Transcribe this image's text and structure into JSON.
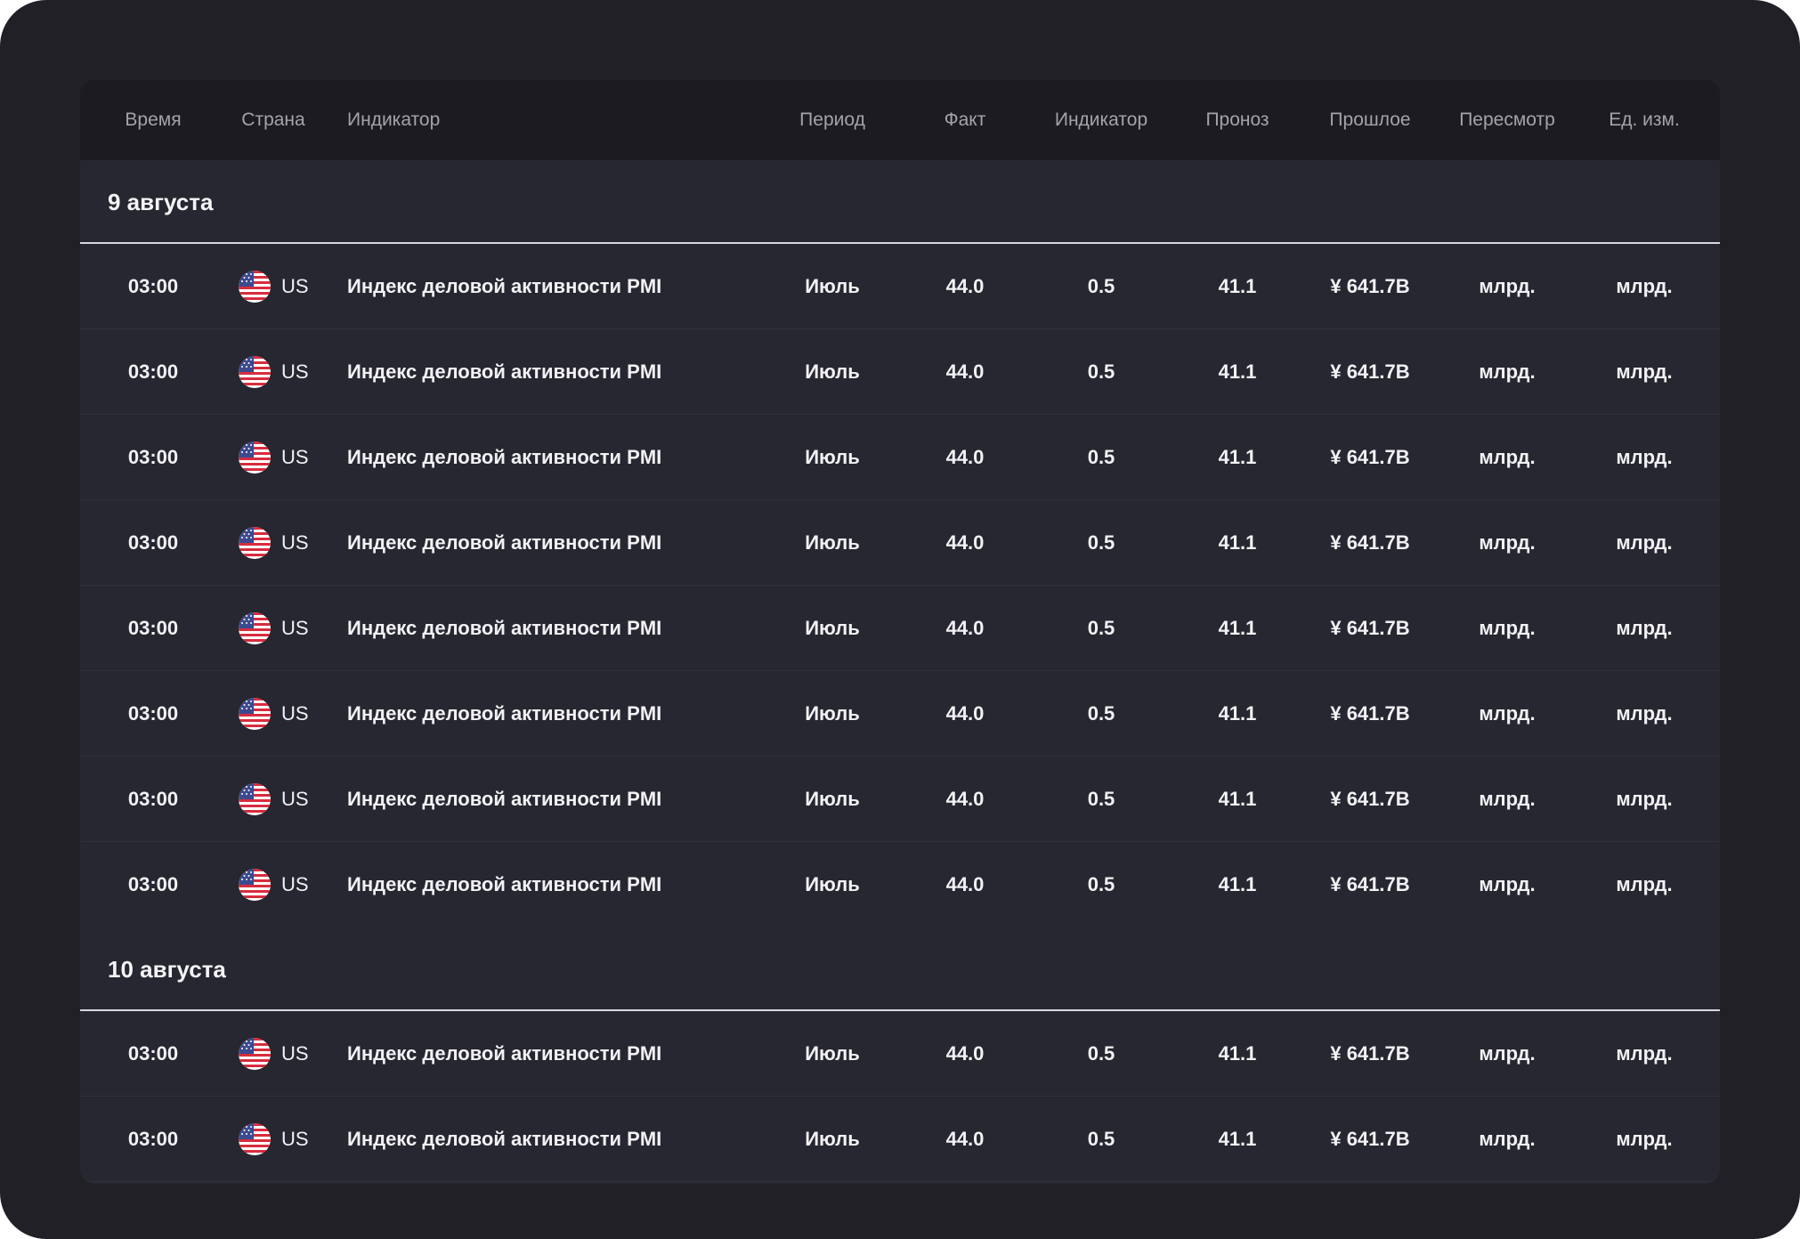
{
  "headers": {
    "time": "Время",
    "country": "Страна",
    "indicator": "Индикатор",
    "period": "Период",
    "actual": "Факт",
    "indicator2": "Индикатор",
    "forecast": "Проноз",
    "previous": "Прошлое",
    "revision": "Пересмотр",
    "unit": "Ед. изм."
  },
  "groups": [
    {
      "date": "9 августа",
      "rows": [
        {
          "time": "03:00",
          "country": "US",
          "indicator": "Индекс деловой активности PMI",
          "period": "Июль",
          "actual": "44.0",
          "indicator2": "0.5",
          "forecast": "41.1",
          "previous": "¥ 641.7B",
          "revision": "млрд.",
          "unit": "млрд."
        },
        {
          "time": "03:00",
          "country": "US",
          "indicator": "Индекс деловой активности PMI",
          "period": "Июль",
          "actual": "44.0",
          "indicator2": "0.5",
          "forecast": "41.1",
          "previous": "¥ 641.7B",
          "revision": "млрд.",
          "unit": "млрд."
        },
        {
          "time": "03:00",
          "country": "US",
          "indicator": "Индекс деловой активности PMI",
          "period": "Июль",
          "actual": "44.0",
          "indicator2": "0.5",
          "forecast": "41.1",
          "previous": "¥ 641.7B",
          "revision": "млрд.",
          "unit": "млрд."
        },
        {
          "time": "03:00",
          "country": "US",
          "indicator": "Индекс деловой активности PMI",
          "period": "Июль",
          "actual": "44.0",
          "indicator2": "0.5",
          "forecast": "41.1",
          "previous": "¥ 641.7B",
          "revision": "млрд.",
          "unit": "млрд."
        },
        {
          "time": "03:00",
          "country": "US",
          "indicator": "Индекс деловой активности PMI",
          "period": "Июль",
          "actual": "44.0",
          "indicator2": "0.5",
          "forecast": "41.1",
          "previous": "¥ 641.7B",
          "revision": "млрд.",
          "unit": "млрд."
        },
        {
          "time": "03:00",
          "country": "US",
          "indicator": "Индекс деловой активности PMI",
          "period": "Июль",
          "actual": "44.0",
          "indicator2": "0.5",
          "forecast": "41.1",
          "previous": "¥ 641.7B",
          "revision": "млрд.",
          "unit": "млрд."
        },
        {
          "time": "03:00",
          "country": "US",
          "indicator": "Индекс деловой активности PMI",
          "period": "Июль",
          "actual": "44.0",
          "indicator2": "0.5",
          "forecast": "41.1",
          "previous": "¥ 641.7B",
          "revision": "млрд.",
          "unit": "млрд."
        },
        {
          "time": "03:00",
          "country": "US",
          "indicator": "Индекс деловой активности PMI",
          "period": "Июль",
          "actual": "44.0",
          "indicator2": "0.5",
          "forecast": "41.1",
          "previous": "¥ 641.7B",
          "revision": "млрд.",
          "unit": "млрд."
        }
      ]
    },
    {
      "date": "10 августа",
      "rows": [
        {
          "time": "03:00",
          "country": "US",
          "indicator": "Индекс деловой активности PMI",
          "period": "Июль",
          "actual": "44.0",
          "indicator2": "0.5",
          "forecast": "41.1",
          "previous": "¥ 641.7B",
          "revision": "млрд.",
          "unit": "млрд."
        },
        {
          "time": "03:00",
          "country": "US",
          "indicator": "Индекс деловой активности PMI",
          "period": "Июль",
          "actual": "44.0",
          "indicator2": "0.5",
          "forecast": "41.1",
          "previous": "¥ 641.7B",
          "revision": "млрд.",
          "unit": "млрд."
        }
      ]
    }
  ],
  "flag_icon": "us-flag-icon"
}
